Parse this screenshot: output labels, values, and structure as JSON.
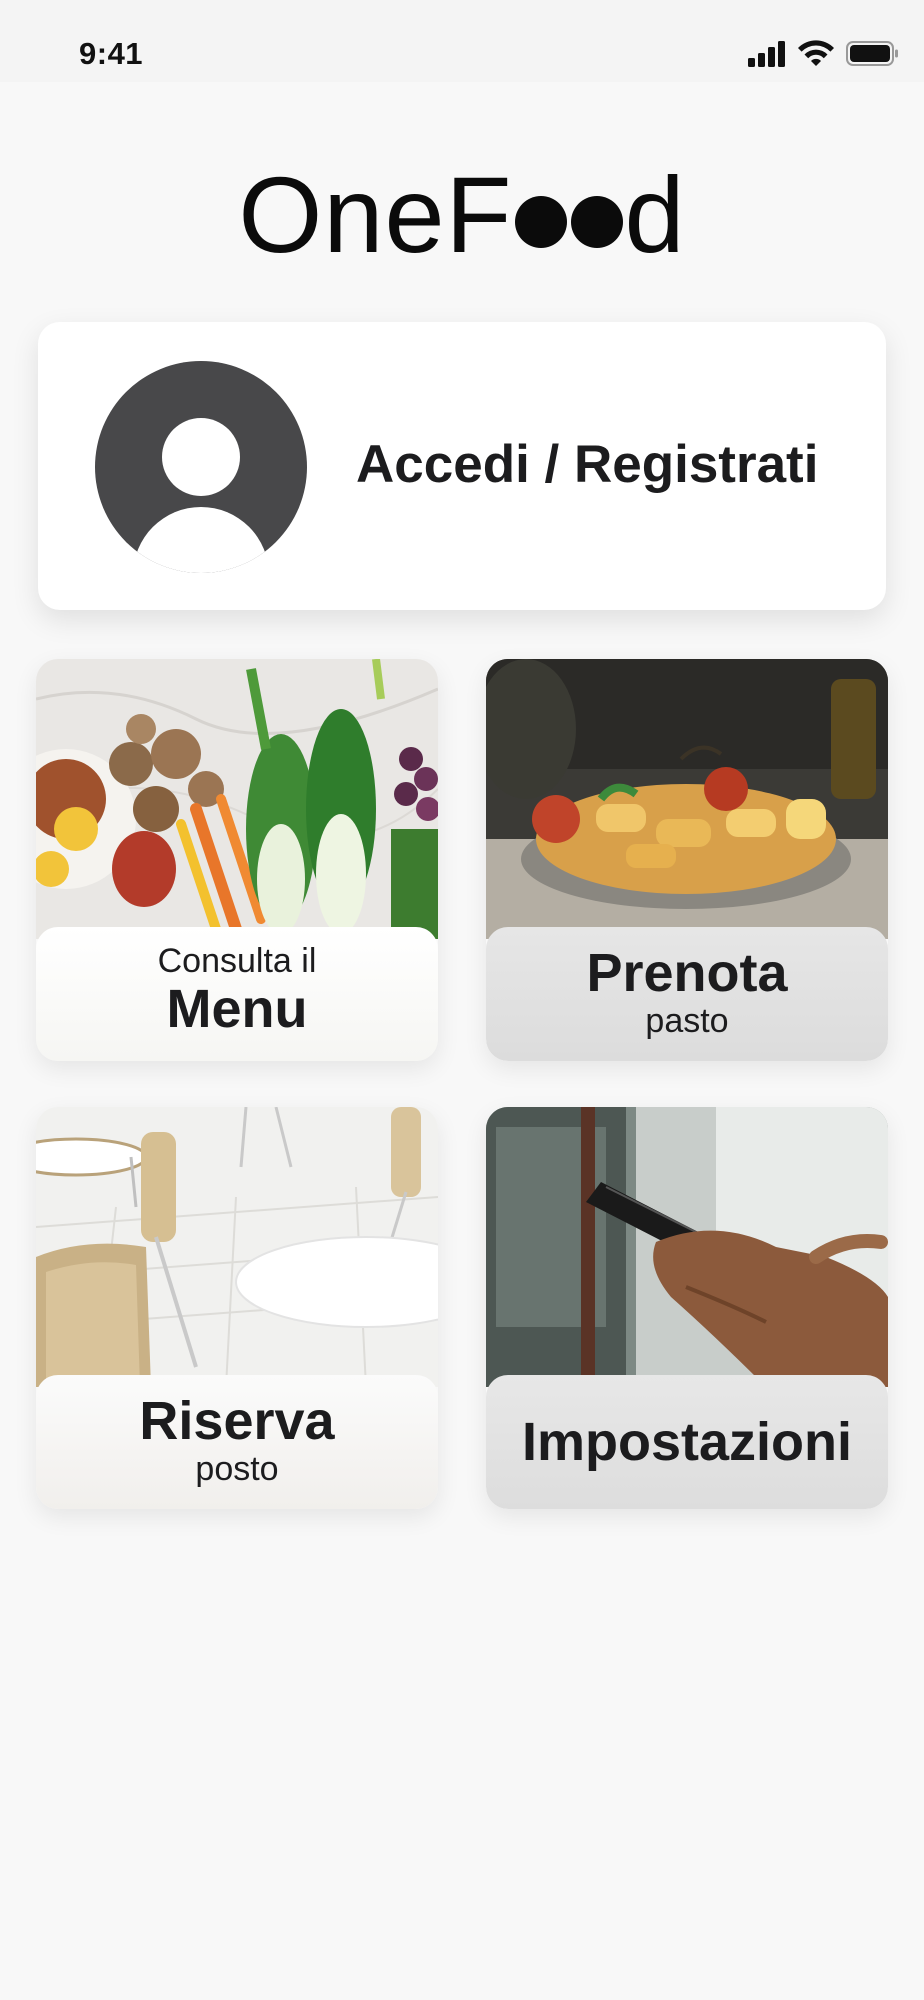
{
  "status_bar": {
    "time": "9:41",
    "icons": [
      "cellular-signal-icon",
      "wifi-icon",
      "battery-icon"
    ]
  },
  "logo": {
    "prefix": "OneF",
    "suffix": "d"
  },
  "login": {
    "label": "Accedi / Registrati",
    "icon": "user-avatar-icon"
  },
  "tiles": [
    {
      "small": "Consulta il",
      "big": "Menu",
      "image": "vegetables-photo"
    },
    {
      "big": "Prenota",
      "small": "pasto",
      "image": "pasta-dish-photo"
    },
    {
      "big": "Riserva",
      "small": "posto",
      "image": "cafeteria-chairs-photo"
    },
    {
      "big": "Impostazioni",
      "image": "hand-holding-phone-photo"
    }
  ],
  "colors": {
    "background": "#f8f8f8",
    "card": "#ffffff",
    "avatar": "#48484a",
    "text": "#1c1c1e"
  }
}
